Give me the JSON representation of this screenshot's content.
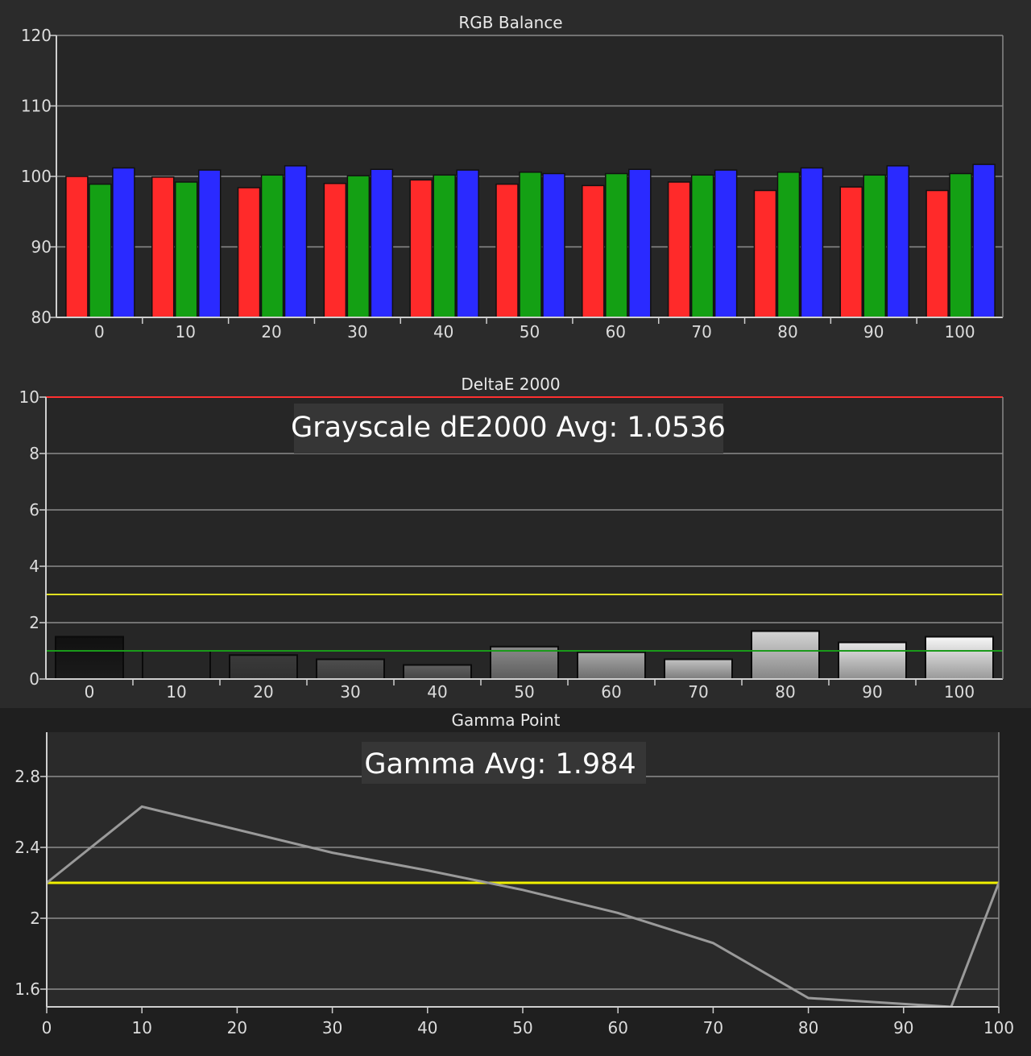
{
  "chart_data": [
    {
      "type": "bar",
      "title": "RGB Balance",
      "categories": [
        "0",
        "10",
        "20",
        "30",
        "40",
        "50",
        "60",
        "70",
        "80",
        "90",
        "100"
      ],
      "ylim": [
        80,
        120
      ],
      "yticks": [
        80,
        90,
        100,
        110,
        120
      ],
      "grid": true,
      "series": [
        {
          "color": "#ff2a2a",
          "values": [
            100.0,
            99.9,
            98.4,
            99.0,
            99.5,
            98.9,
            98.7,
            99.2,
            98.0,
            98.5,
            98.0
          ]
        },
        {
          "color": "#14a014",
          "values": [
            98.9,
            99.2,
            100.2,
            100.1,
            100.2,
            100.6,
            100.4,
            100.2,
            100.6,
            100.2,
            100.4
          ]
        },
        {
          "color": "#2a2aff",
          "values": [
            101.2,
            100.9,
            101.5,
            101.0,
            100.9,
            100.4,
            101.0,
            100.9,
            101.2,
            101.5,
            101.7
          ]
        }
      ]
    },
    {
      "type": "bar",
      "title": "DeltaE 2000",
      "categories": [
        "0",
        "10",
        "20",
        "30",
        "40",
        "50",
        "60",
        "70",
        "80",
        "90",
        "100"
      ],
      "ylim": [
        0,
        10
      ],
      "yticks": [
        0,
        2,
        4,
        6,
        8,
        10
      ],
      "grid": true,
      "values": [
        1.5,
        1.0,
        0.85,
        0.7,
        0.5,
        1.15,
        0.95,
        0.7,
        1.7,
        1.3,
        1.5
      ],
      "bar_shades": [
        "#111111",
        "#262626",
        "#3a3a3a",
        "#4e4e4e",
        "#606060",
        "#8a8a8a",
        "#a8a8a8",
        "#c2c2c2",
        "#d4d4d4",
        "#e6e6e6",
        "#f7f7f7"
      ],
      "reference_lines": [
        {
          "value": 10,
          "color": "#ff3030"
        },
        {
          "value": 3,
          "color": "#e0e020"
        },
        {
          "value": 1,
          "color": "#1a9a1a"
        }
      ],
      "annotation": "Grayscale dE2000 Avg: 1.0536"
    },
    {
      "type": "line",
      "title": "Gamma Point",
      "x": [
        0,
        10,
        30,
        40,
        50,
        60,
        70,
        80,
        95,
        100
      ],
      "xticks": [
        0,
        10,
        20,
        30,
        40,
        50,
        60,
        70,
        80,
        90,
        100
      ],
      "xlim": [
        0,
        100
      ],
      "ylim": [
        1.5,
        3.05
      ],
      "yticks": [
        1.6,
        2.0,
        2.4,
        2.8
      ],
      "ytick_labels": [
        "1.6",
        "2",
        "2.4",
        "2.8"
      ],
      "grid": true,
      "series": [
        {
          "color": "#9a9a9a",
          "values": [
            2.2,
            2.63,
            2.37,
            2.27,
            2.16,
            2.03,
            1.86,
            1.55,
            1.5,
            2.2
          ]
        }
      ],
      "reference_lines": [
        {
          "value": 2.2,
          "color": "#f0f000"
        }
      ],
      "annotation": "Gamma Avg: 1.984"
    }
  ]
}
